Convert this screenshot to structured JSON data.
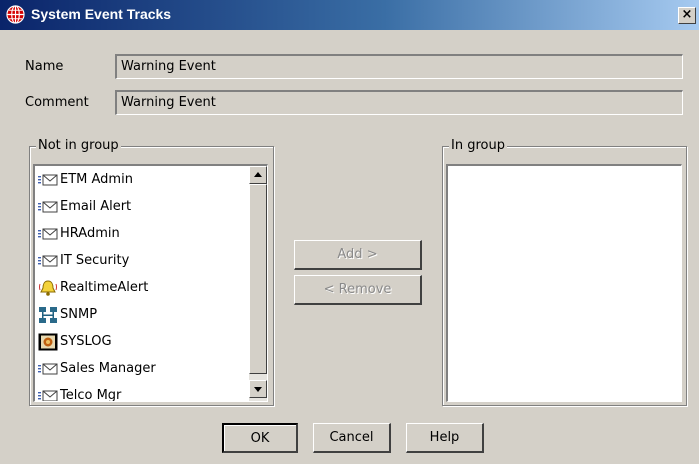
{
  "window": {
    "title": "System Event Tracks",
    "close_glyph": "×"
  },
  "form": {
    "name_label": "Name",
    "name_value": "Warning Event",
    "comment_label": "Comment",
    "comment_value": "Warning Event"
  },
  "not_in_group": {
    "legend": "Not in group",
    "items": [
      {
        "label": "ETM Admin",
        "icon": "email-contact-icon"
      },
      {
        "label": "Email Alert",
        "icon": "email-contact-icon"
      },
      {
        "label": "HRAdmin",
        "icon": "email-contact-icon"
      },
      {
        "label": "IT Security",
        "icon": "email-contact-icon"
      },
      {
        "label": "RealtimeAlert",
        "icon": "bell-alert-icon"
      },
      {
        "label": "SNMP",
        "icon": "network-icon"
      },
      {
        "label": "SYSLOG",
        "icon": "syslog-icon"
      },
      {
        "label": "Sales Manager",
        "icon": "email-contact-icon"
      },
      {
        "label": "Telco Mgr",
        "icon": "email-contact-icon"
      }
    ]
  },
  "in_group": {
    "legend": "In group",
    "items": []
  },
  "actions": {
    "add_label": "Add >",
    "remove_label": "< Remove"
  },
  "footer": {
    "ok_label": "OK",
    "cancel_label": "Cancel",
    "help_label": "Help"
  },
  "colors": {
    "dialog_bg": "#d4d0c8",
    "titlebar_start": "#0a246a",
    "titlebar_end": "#a6caf0",
    "disabled_text": "#8a8a8a"
  }
}
